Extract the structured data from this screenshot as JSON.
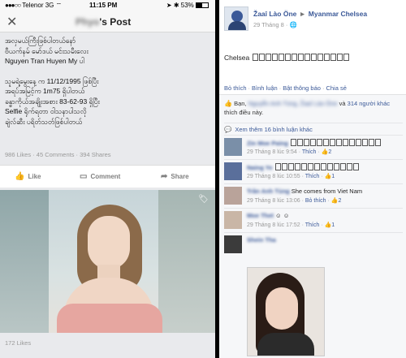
{
  "left": {
    "status": {
      "carrier": "Telenor",
      "network": "3G",
      "time": "11:15 PM",
      "battery": "53%",
      "battery_level": 0.53
    },
    "nav": {
      "title_suffix": "'s Post",
      "blurred_name": "Phyo"
    },
    "post_lines": [
      "အလှမယ်ကြီးဖြစ်ပါတယ်နော်",
      "ဗီယက်နမ် မော်ဒယ် မင်းသမီးလေး",
      "Nguyen Tran Huyen My ပါ",
      "",
      "သူမရဲ့မွေးနေ့ က 11/12/1995 ဖြစ်ပြီး",
      "အရပ်အမြင့်က 1m75 ရှိပါတယ်",
      "ခန္ဓာကိုယ်အချိုးအစား 83-62-93 ရှိပြီး",
      "Selfie ရိုက်ရတာ ဝါသနာပါသလို",
      "ချဲလ်ဆီး ပရိတ်သတ်ဖြစ်ပါတယ်"
    ],
    "counts": {
      "likes": "986 Likes",
      "comments": "45 Comments",
      "shares": "394 Shares"
    },
    "actions": {
      "like": "Like",
      "comment": "Comment",
      "share": "Share"
    },
    "bottom_likes": "172 Likes"
  },
  "right": {
    "header": {
      "author": "Žaaî Lào Öne",
      "arrow": "►",
      "target": "Myanmar Chelsea",
      "date": "29 Tháng 8",
      "privacy": "🌐"
    },
    "body_prefix": "Chelsea",
    "body_box_count": 15,
    "post_actions": [
      "Bỏ thích",
      "Bình luận",
      "Bật thông báo",
      "Chia sẻ"
    ],
    "likes_text": {
      "prefix": "Bạn,",
      "blurred": "Nguyễn Anh Tùng, Žaaî Lào Öne",
      "middle": "và",
      "others": "314 người khác",
      "suffix": "thích điều này."
    },
    "more_comments": "Xem thêm 16 bình luận khác",
    "comments": [
      {
        "name": "Zin Moe Paing",
        "text_boxes": 14,
        "text": "",
        "time": "29 Tháng 8 lúc 9:54",
        "action": "Thích",
        "likes": "2"
      },
      {
        "name": "Naing Ye",
        "text_boxes": 13,
        "text": "",
        "time": "29 Tháng 8 lúc 10:55",
        "action": "Thích",
        "likes": "1"
      },
      {
        "name": "Trần Anh Tùng",
        "text_boxes": 0,
        "text": "She comes from Viet Nam",
        "time": "29 Tháng 8 lúc 13:06",
        "action": "Bỏ thích",
        "likes": "2"
      },
      {
        "name": "Moe Thet",
        "text_boxes": 0,
        "text": "☺ ☺",
        "time": "29 Tháng 8 lúc 17:52",
        "action": "Thích",
        "likes": "1"
      },
      {
        "name": "Shein Tha",
        "text_boxes": 0,
        "text": "",
        "time": "",
        "action": "",
        "likes": ""
      }
    ]
  }
}
